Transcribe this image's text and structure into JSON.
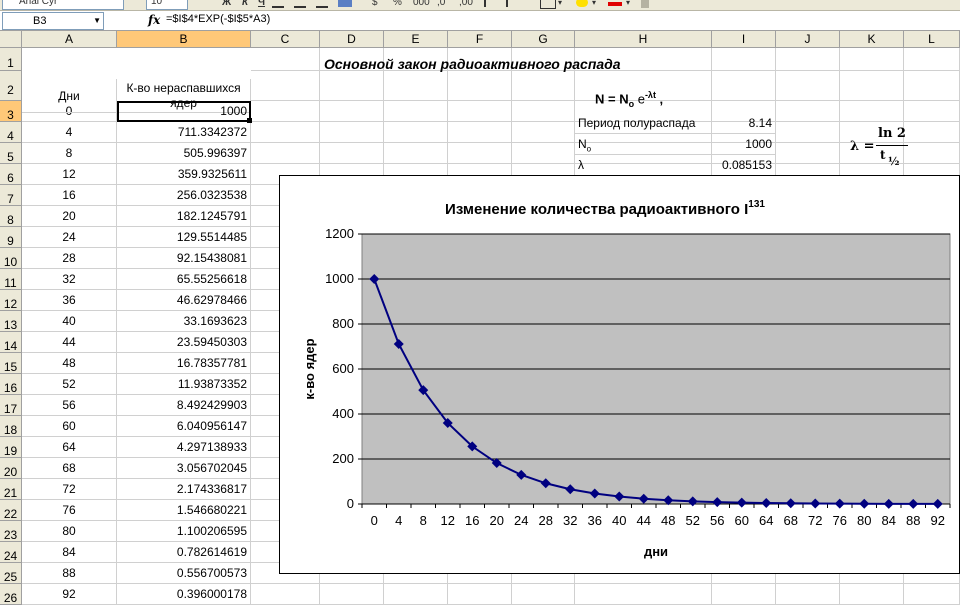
{
  "toolbar": {
    "font_name": "Arial Cyr",
    "font_size": "10",
    "bold_btn": "Ж",
    "italic_btn": "К",
    "underline_btn": "Ч",
    "currency_btn": "$",
    "percent_btn": "%",
    "thousands_btn": "000",
    "dec_inc_btn": ",0",
    "dec_dec_btn": ",00"
  },
  "formula_bar": {
    "cell_ref": "B3",
    "fx_label": "fx",
    "formula": "=$I$4*EXP(-$I$5*A3)"
  },
  "columns": [
    "A",
    "B",
    "C",
    "D",
    "E",
    "F",
    "G",
    "H",
    "I",
    "J",
    "K",
    "L"
  ],
  "rows": [
    "1",
    "2",
    "3",
    "4",
    "5",
    "6",
    "7",
    "8",
    "9",
    "10",
    "11",
    "12",
    "13",
    "14",
    "15",
    "16",
    "17",
    "18",
    "19",
    "20",
    "21",
    "22",
    "23",
    "24",
    "25",
    "26"
  ],
  "sheet": {
    "title": "Основной закон радиоактивного распада",
    "header_days": "Дни",
    "header_nuclei_line1": "К-во нераспавшихся",
    "header_nuclei_line2": "ядер",
    "formula_N": "N = N",
    "formula_sub_o": "o",
    "formula_e": " e",
    "formula_exp": "-λt",
    "formula_comma": " ,",
    "label_half_life": "Период полураспада",
    "value_half_life": "8.14",
    "label_N0": "N",
    "label_N0_sub": "o",
    "value_N0": "1000",
    "label_lambda": "λ",
    "value_lambda": "0.085153",
    "lam_lhs": "λ =",
    "lam_num": "ln 2",
    "lam_den": "t",
    "lam_den_sub": "½"
  },
  "table": {
    "days": [
      "0",
      "4",
      "8",
      "12",
      "16",
      "20",
      "24",
      "28",
      "32",
      "36",
      "40",
      "44",
      "48",
      "52",
      "56",
      "60",
      "64",
      "68",
      "72",
      "76",
      "80",
      "84",
      "88",
      "92"
    ],
    "nuclei": [
      "1000",
      "711.3342372",
      "505.996397",
      "359.9325611",
      "256.0323538",
      "182.1245791",
      "129.5514485",
      "92.15438081",
      "65.55256618",
      "46.62978466",
      "33.1693623",
      "23.59450303",
      "16.78357781",
      "11.93873352",
      "8.492429903",
      "6.040956147",
      "4.297138933",
      "3.056702045",
      "2.174336817",
      "1.546680221",
      "1.100206595",
      "0.782614619",
      "0.556700573",
      "0.396000178"
    ]
  },
  "chart_data": {
    "type": "line",
    "title": "Изменение количества радиоактивного  I",
    "title_sup": "131",
    "xlabel": "дни",
    "ylabel": "к-во ядер",
    "categories": [
      "0",
      "4",
      "8",
      "12",
      "16",
      "20",
      "24",
      "28",
      "32",
      "36",
      "40",
      "44",
      "48",
      "52",
      "56",
      "60",
      "64",
      "68",
      "72",
      "76",
      "80",
      "84",
      "88",
      "92"
    ],
    "values": [
      1000,
      711.3342372,
      505.996397,
      359.9325611,
      256.0323538,
      182.1245791,
      129.5514485,
      92.15438081,
      65.55256618,
      46.62978466,
      33.1693623,
      23.59450303,
      16.78357781,
      11.93873352,
      8.492429903,
      6.040956147,
      4.297138933,
      3.056702045,
      2.174336817,
      1.546680221,
      1.100206595,
      0.782614619,
      0.556700573,
      0.396000178
    ],
    "ylim": [
      0,
      1200
    ],
    "yticks": [
      "0",
      "200",
      "400",
      "600",
      "800",
      "1000",
      "1200"
    ],
    "grid": "horizontal",
    "legend": "none",
    "plot_bg": "#c0c0c0",
    "line_color": "#000080",
    "marker": "diamond"
  }
}
